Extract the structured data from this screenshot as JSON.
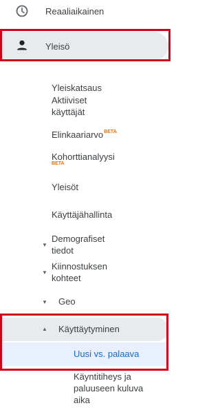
{
  "nav": {
    "realtime": {
      "label": "Reaaliaikainen",
      "icon": "clock-icon"
    },
    "audience": {
      "label": "Yleisö",
      "icon": "person-icon"
    },
    "audience_items": [
      {
        "label": "Yleiskatsaus"
      },
      {
        "label": "Aktiiviset käyttäjät"
      },
      {
        "label": "Elinkaariarvo",
        "badge": "BETA"
      },
      {
        "label": "Kohorttianalyysi",
        "badge": "BETA"
      },
      {
        "label": "Yleisöt"
      },
      {
        "label": "Käyttäjähallinta"
      }
    ],
    "collapsible": [
      {
        "label": "Demografiset tiedot",
        "state": "collapsed"
      },
      {
        "label": "Kiinnostuksen kohteet",
        "state": "collapsed"
      },
      {
        "label": "Geo",
        "state": "collapsed"
      }
    ],
    "behavior": {
      "label": "Käyttäytyminen",
      "state": "expanded",
      "items": [
        {
          "label": "Uusi vs. palaava",
          "selected": true
        },
        {
          "label": "Käyntitiheys ja paluuseen kuluva aika"
        }
      ]
    },
    "colors": {
      "highlight_box": "#d0021b",
      "selected_text": "#1967d2",
      "selected_bg": "#e8f0fe",
      "beta_badge": "#e8710a"
    }
  }
}
